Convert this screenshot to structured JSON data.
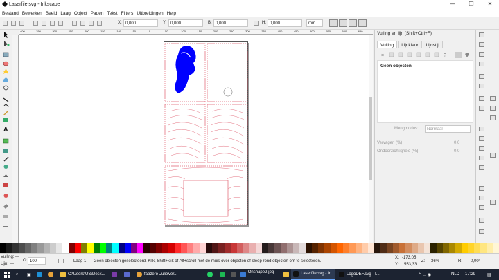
{
  "window": {
    "title": "Laserfile.svg - Inkscape",
    "minimize": "—",
    "maximize": "❐",
    "close": "✕"
  },
  "menu": [
    "Bestand",
    "Bewerken",
    "Beeld",
    "Laag",
    "Object",
    "Paden",
    "Tekst",
    "Filters",
    "Uitbreidingen",
    "Help"
  ],
  "toolbar": {
    "x_label": "X:",
    "x_value": "0,000",
    "y_label": "Y:",
    "y_value": "0,000",
    "w_label": "B:",
    "w_value": "0,000",
    "h_label": "H:",
    "h_value": "0,000",
    "unit": "mm"
  },
  "ruler_ticks": [
    "400",
    "350",
    "300",
    "250",
    "200",
    "150",
    "100",
    "50",
    "0",
    "50",
    "100",
    "150",
    "200",
    "250",
    "300",
    "350",
    "400",
    "450",
    "500",
    "550",
    "600",
    "650"
  ],
  "panel": {
    "title": "Vulling en lijn (Shift+Ctrl+F)",
    "tabs": [
      "Vulling",
      "Lijnkleur",
      "Lijnstijl"
    ],
    "empty_text": "Geen objecten",
    "blend_label": "Mengmodus:",
    "blend_value": "Normaal",
    "blur_label": "Vervagen (%)",
    "blur_value": "0,0",
    "opacity_label": "Ondoorzichtigheid (%)",
    "opacity_value": "0,0"
  },
  "palette_colors": [
    "#000000",
    "#1a1a1a",
    "#333333",
    "#4d4d4d",
    "#666666",
    "#808080",
    "#999999",
    "#b3b3b3",
    "#cccccc",
    "#e6e6e6",
    "#ffffff",
    "#800000",
    "#ff0000",
    "#808000",
    "#ffff00",
    "#008000",
    "#00ff00",
    "#008080",
    "#00ffff",
    "#000080",
    "#0000ff",
    "#800080",
    "#ff00ff",
    "#2b0000",
    "#550000",
    "#800000",
    "#aa0000",
    "#d40000",
    "#ff2a2a",
    "#ff5555",
    "#ff8080",
    "#ffaaaa",
    "#ffd5d5",
    "#280b0b",
    "#501616",
    "#782121",
    "#a02c2c",
    "#c83737",
    "#d35f5f",
    "#de8787",
    "#e9afaf",
    "#f4d7d7",
    "#241c1c",
    "#483737",
    "#6c5353",
    "#916f6f",
    "#ac9393",
    "#c8b7b7",
    "#e3dbdb",
    "#2b1100",
    "#552200",
    "#803300",
    "#aa4400",
    "#d45500",
    "#ff6600",
    "#ff7f2a",
    "#ff9955",
    "#ffb380",
    "#ffccaa",
    "#ffe6d5",
    "#28170b",
    "#502d16",
    "#784421",
    "#a05a2c",
    "#c87137",
    "#d38d5f",
    "#deaa87",
    "#e9c6af",
    "#f4e3d7",
    "#2b2200",
    "#554400",
    "#806600",
    "#aa8800",
    "#d4aa00",
    "#ffcc00",
    "#ffd42a",
    "#ffdd55",
    "#ffe680",
    "#ffeeaa",
    "#fff6d5"
  ],
  "status": {
    "fill_label": "Vulling:",
    "fill_value": "---",
    "stroke_label": "Lijn:",
    "stroke_value": "---",
    "opacity_label": "O:",
    "opacity_value": "100",
    "layer": "-Laag 1",
    "message": "Geen objecten geselecteerd. Klik, Shift+klik of Alt+scroll met de muis over objecten of sleep rond objecten om te selecteren.",
    "x_label": "X:",
    "x_value": "-173,05",
    "y_label": "Y:",
    "y_value": "553,33",
    "z_label": "Z:",
    "zoom": "36%",
    "r_label": "R:",
    "rotation": "0,00°"
  },
  "taskbar": {
    "tasks": [
      "C:\\Users\\US\\Desk...",
      "fabzero-JulieVer...",
      "Onshape2.jpg - ...",
      "Laserfile.svg - In...",
      "LogoDEF.svg - I..."
    ],
    "language": "NLD",
    "time": "17:29"
  },
  "colors": {
    "accent": "#0000ff",
    "cut_lines": "#e06070"
  }
}
